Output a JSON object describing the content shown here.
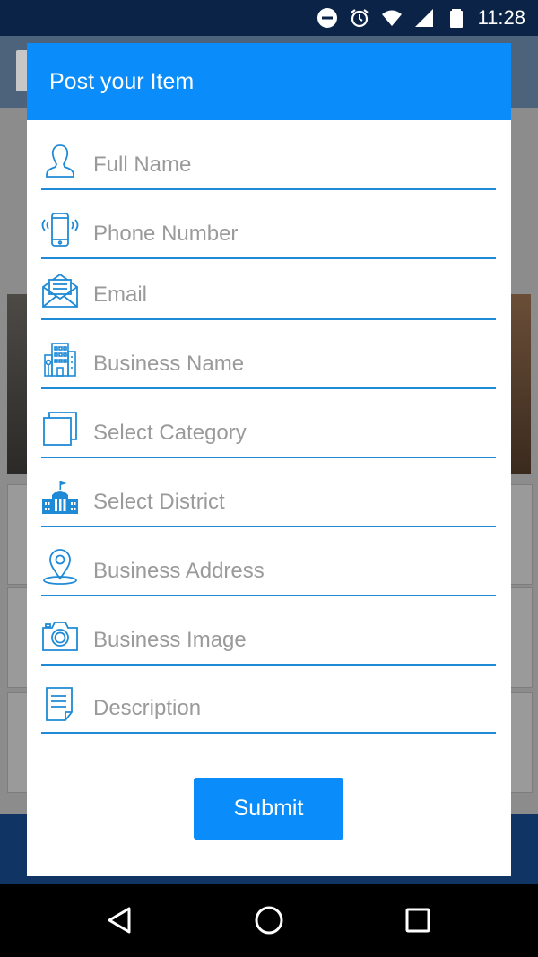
{
  "status_bar": {
    "time": "11:28",
    "icons": [
      "do-not-disturb-icon",
      "alarm-icon",
      "wifi-icon",
      "signal-icon",
      "battery-icon"
    ]
  },
  "dialog": {
    "title": "Post your Item",
    "fields": [
      {
        "placeholder": "Full Name",
        "icon": "person-icon"
      },
      {
        "placeholder": "Phone Number",
        "icon": "phone-icon"
      },
      {
        "placeholder": "Email",
        "icon": "email-icon"
      },
      {
        "placeholder": "Business Name",
        "icon": "building-icon"
      },
      {
        "placeholder": "Select Category",
        "icon": "category-icon"
      },
      {
        "placeholder": "Select District",
        "icon": "district-icon"
      },
      {
        "placeholder": "Business Address",
        "icon": "location-pin-icon"
      },
      {
        "placeholder": "Business Image",
        "icon": "camera-icon"
      },
      {
        "placeholder": "Description",
        "icon": "document-icon"
      }
    ],
    "submit_label": "Submit"
  },
  "nav_bar": {
    "buttons": [
      "back-icon",
      "home-icon",
      "recents-icon"
    ]
  },
  "colors": {
    "accent": "#0a8dfa",
    "underline": "#1f8ad6",
    "status_bar": "#0b2346",
    "placeholder": "#9a9a9a"
  }
}
